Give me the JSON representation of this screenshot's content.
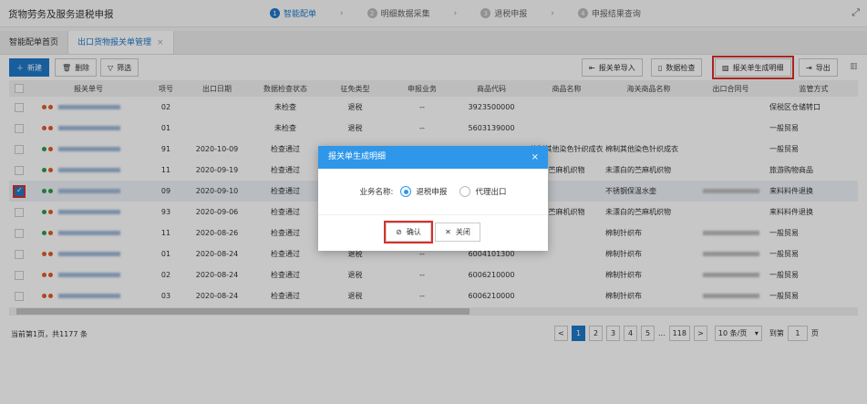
{
  "app_title": "货物劳务及服务退税申报",
  "steps": [
    {
      "n": "1",
      "label": "智能配单"
    },
    {
      "n": "2",
      "label": "明细数据采集"
    },
    {
      "n": "3",
      "label": "退税申报"
    },
    {
      "n": "4",
      "label": "申报结果查询"
    }
  ],
  "tabs": [
    {
      "label": "智能配单首页"
    },
    {
      "label": "出口货物报关单管理"
    }
  ],
  "toolbar": {
    "new": "新建",
    "delete": "删除",
    "filter": "筛选",
    "import": "报关单导入",
    "check": "数据检查",
    "generate": "报关单生成明细",
    "export": "导出"
  },
  "columns": [
    "报关单号",
    "项号",
    "出口日期",
    "数据检查状态",
    "征免类型",
    "申报业务",
    "商品代码",
    "商品名称",
    "海关商品名称",
    "出口合同号",
    "监管方式"
  ],
  "rows": [
    {
      "dots": [
        "#e05a2b",
        "#e05a2b"
      ],
      "item": "02",
      "date": "",
      "status": "未检查",
      "tax": "退税",
      "biz": "--",
      "code": "3923500000",
      "name": "",
      "cname": "",
      "contract": false,
      "mode": "保税区仓储转口"
    },
    {
      "dots": [
        "#e05a2b",
        "#e05a2b"
      ],
      "item": "01",
      "date": "",
      "status": "未检查",
      "tax": "退税",
      "biz": "--",
      "code": "5603139000",
      "name": "",
      "cname": "",
      "contract": false,
      "mode": "一般贸易"
    },
    {
      "dots": [
        "#2e9a45",
        "#e05a2b"
      ],
      "item": "91",
      "date": "2020-10-09",
      "status": "检查通过",
      "tax": "",
      "biz": "",
      "code": "",
      "name": "棉制其他染色针织成衣",
      "cname": "棉制其他染色针织成衣",
      "contract": false,
      "mode": "一般贸易"
    },
    {
      "dots": [
        "#2e9a45",
        "#e05a2b"
      ],
      "item": "11",
      "date": "2020-09-19",
      "status": "检查通过",
      "tax": "",
      "biz": "",
      "code": "",
      "name": "苎麻机织物",
      "cname": "未漂白的苎麻机织物",
      "contract": false,
      "mode": "旅游购物商品"
    },
    {
      "dots": [
        "#2e9a45",
        "#2e9a45"
      ],
      "item": "09",
      "date": "2020-09-10",
      "status": "检查通过",
      "tax": "",
      "biz": "",
      "code": "",
      "name": "",
      "cname": "不锈钢保温水壶",
      "contract": true,
      "mode": "来料料件退换",
      "selected": true
    },
    {
      "dots": [
        "#2e9a45",
        "#e05a2b"
      ],
      "item": "93",
      "date": "2020-09-06",
      "status": "检查通过",
      "tax": "",
      "biz": "",
      "code": "",
      "name": "苎麻机织物",
      "cname": "未漂白的苎麻机织物",
      "contract": false,
      "mode": "来料料件退换"
    },
    {
      "dots": [
        "#2e9a45",
        "#e05a2b"
      ],
      "item": "11",
      "date": "2020-08-26",
      "status": "检查通过",
      "tax": "",
      "biz": "",
      "code": "",
      "name": "",
      "cname": "棉制针织布",
      "contract": true,
      "mode": "一般贸易"
    },
    {
      "dots": [
        "#e05a2b",
        "#e05a2b"
      ],
      "item": "01",
      "date": "2020-08-24",
      "status": "检查通过",
      "tax": "退税",
      "biz": "--",
      "code": "6004101300",
      "name": "",
      "cname": "棉制针织布",
      "contract": true,
      "mode": "一般贸易"
    },
    {
      "dots": [
        "#e05a2b",
        "#e05a2b"
      ],
      "item": "02",
      "date": "2020-08-24",
      "status": "检查通过",
      "tax": "退税",
      "biz": "--",
      "code": "6006210000",
      "name": "",
      "cname": "棉制针织布",
      "contract": true,
      "mode": "一般贸易"
    },
    {
      "dots": [
        "#e05a2b",
        "#e05a2b"
      ],
      "item": "03",
      "date": "2020-08-24",
      "status": "检查通过",
      "tax": "退税",
      "biz": "--",
      "code": "6006210000",
      "name": "",
      "cname": "棉制针织布",
      "contract": true,
      "mode": "一般贸易"
    }
  ],
  "footer": {
    "summary": "当前第1页，共1177 条",
    "pages": [
      "1",
      "2",
      "3",
      "4",
      "5",
      "...",
      "118"
    ],
    "prev": "<",
    "next": ">",
    "page_size": "10 条/页",
    "goto_label": "到第",
    "goto_value": "1",
    "goto_suffix": "页"
  },
  "dialog": {
    "title": "报关单生成明细",
    "close": "×",
    "field_label": "业务名称:",
    "options": [
      "退税申报",
      "代理出口"
    ],
    "selected": 0,
    "confirm": "确认",
    "cancel": "关闭"
  }
}
